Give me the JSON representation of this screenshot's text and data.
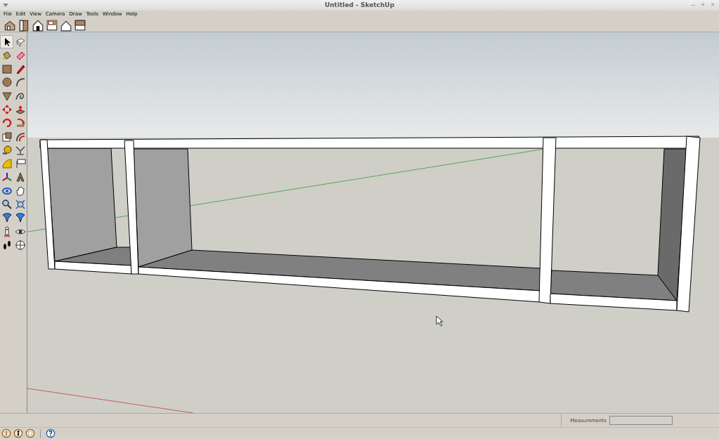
{
  "window": {
    "title": "Untitled - SketchUp",
    "controls": [
      "–",
      "+",
      "×"
    ]
  },
  "menu": [
    "File",
    "Edit",
    "View",
    "Camera",
    "Draw",
    "Tools",
    "Window",
    "Help"
  ],
  "status_bar": {
    "measurements_label": "Measurements"
  }
}
